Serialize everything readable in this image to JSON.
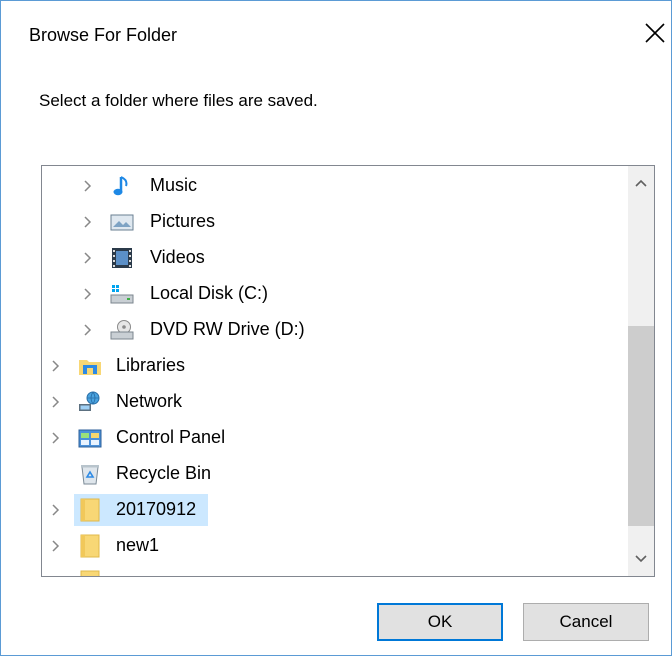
{
  "dialog": {
    "title": "Browse For Folder",
    "prompt": "Select a folder where files are saved.",
    "ok_label": "OK",
    "cancel_label": "Cancel"
  },
  "tree": {
    "items": [
      {
        "label": "Music",
        "icon": "music-icon",
        "expandable": true
      },
      {
        "label": "Pictures",
        "icon": "pictures-icon",
        "expandable": true
      },
      {
        "label": "Videos",
        "icon": "videos-icon",
        "expandable": true
      },
      {
        "label": "Local Disk (C:)",
        "icon": "local-disk-icon",
        "expandable": true
      },
      {
        "label": "DVD RW Drive (D:)",
        "icon": "dvd-drive-icon",
        "expandable": true
      },
      {
        "label": "Libraries",
        "icon": "libraries-icon",
        "expandable": true
      },
      {
        "label": "Network",
        "icon": "network-icon",
        "expandable": true
      },
      {
        "label": "Control Panel",
        "icon": "control-panel-icon",
        "expandable": true
      },
      {
        "label": "Recycle Bin",
        "icon": "recycle-bin-icon",
        "expandable": false
      },
      {
        "label": "20170912",
        "icon": "folder-icon",
        "expandable": true,
        "selected": true
      },
      {
        "label": "new1",
        "icon": "folder-icon",
        "expandable": true
      }
    ]
  },
  "colors": {
    "selection": "#cce8ff",
    "accent": "#0078d7"
  }
}
